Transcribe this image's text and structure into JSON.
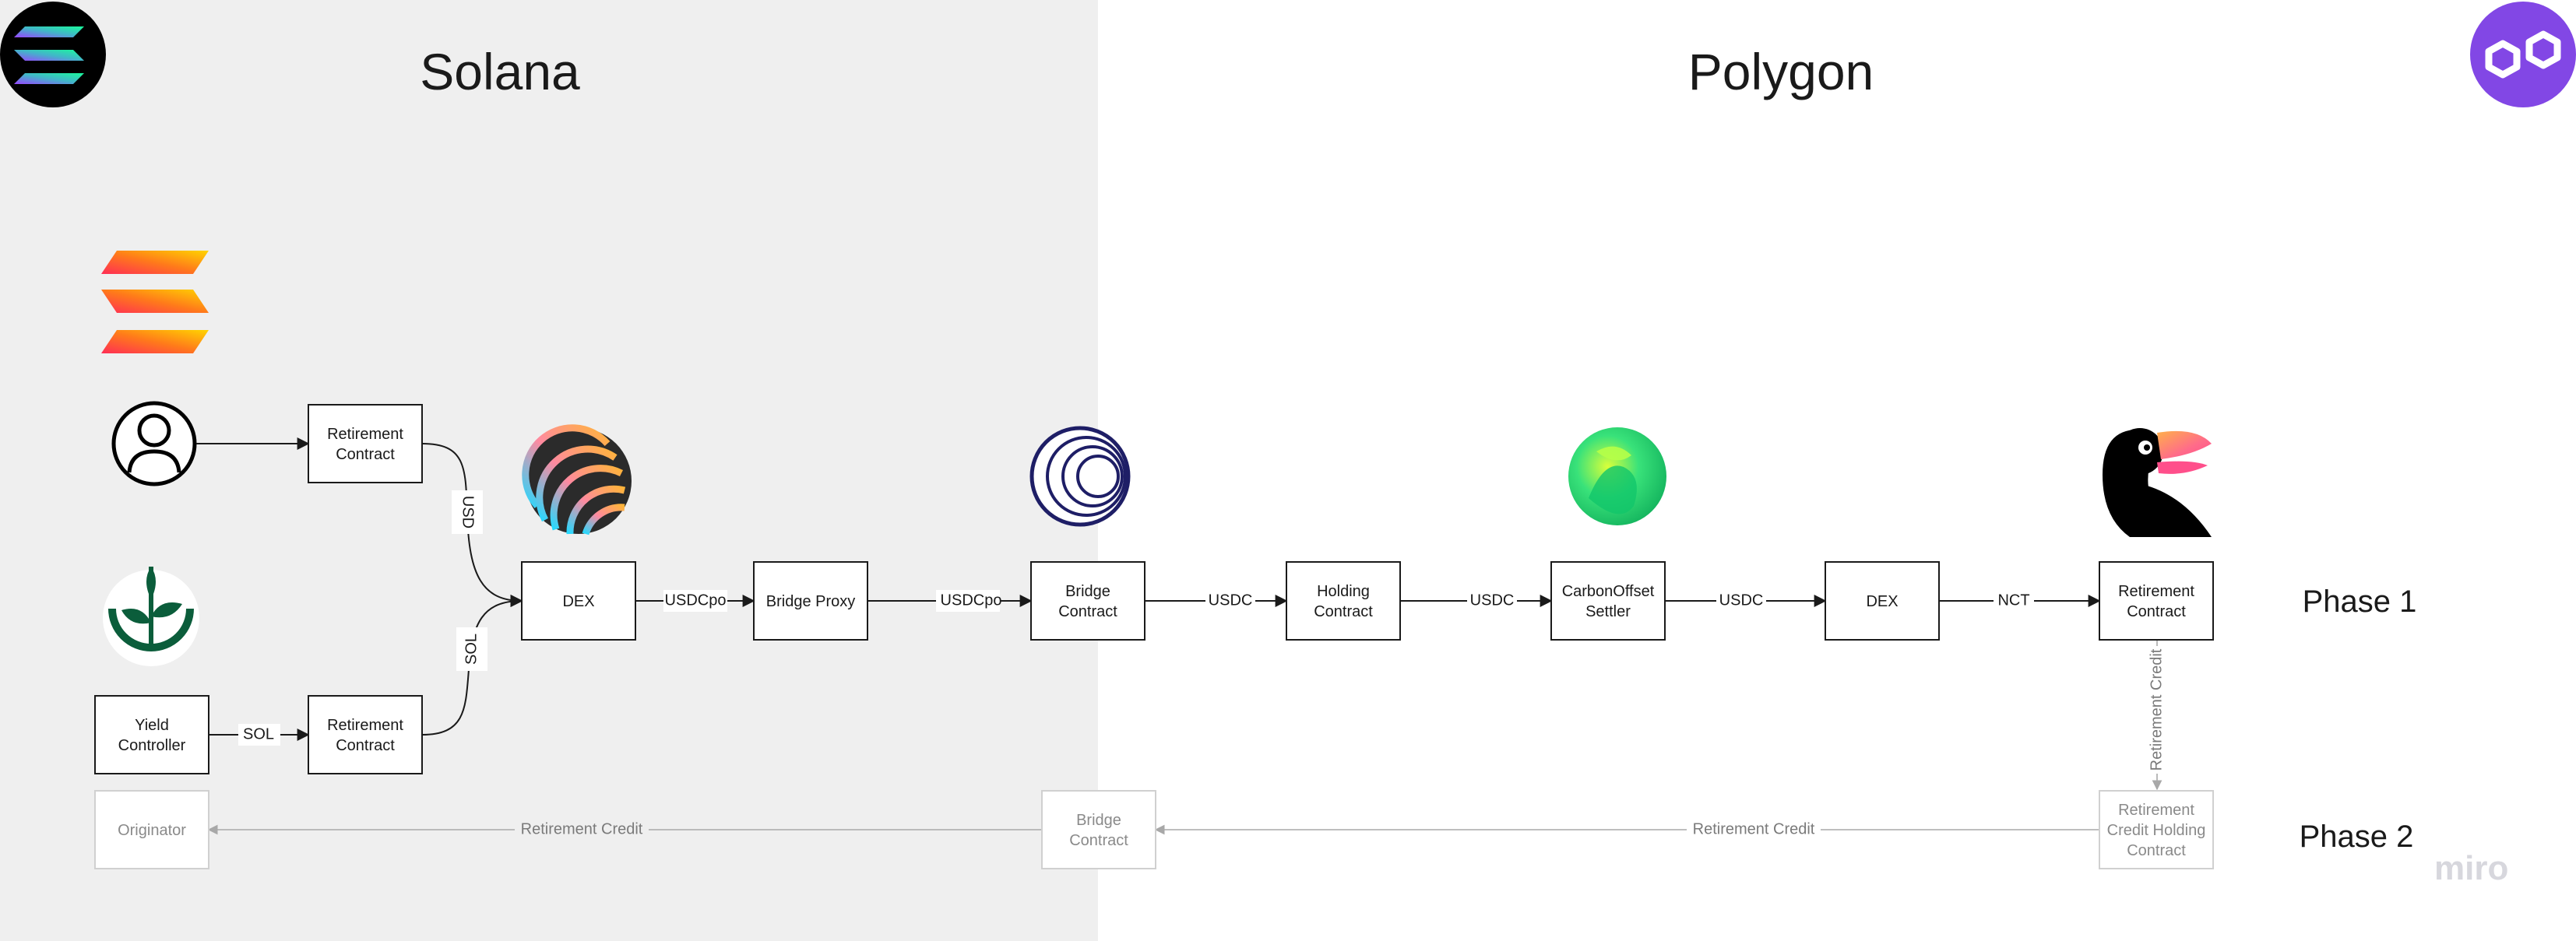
{
  "regions": {
    "left": {
      "title": "Solana"
    },
    "right": {
      "title": "Polygon"
    }
  },
  "colors": {
    "left_background": "#efefef",
    "right_background": "#ffffff",
    "node_border": "#1a1a1a",
    "faded_node_border": "#d0d0d0",
    "faded_text": "#8a8a8a",
    "polygon_purple": "#8247e5"
  },
  "icons": {
    "solana_logo": "solana-logo-icon",
    "polygon_logo": "polygon-logo-icon",
    "solana_orange": "solana-orange-logo-icon",
    "user": "user-icon",
    "plant": "plant-seedling-icon",
    "dex": "orca-striped-logo-icon",
    "bridge": "wormhole-circles-icon",
    "carbon": "green-blob-logo-icon",
    "toucan": "toucan-logo-icon"
  },
  "nodes": {
    "retirement_contract_top": [
      "Retirement",
      "Contract"
    ],
    "yield_controller": [
      "Yield",
      "Controller"
    ],
    "retirement_contract_bottom": [
      "Retirement",
      "Contract"
    ],
    "dex_solana": [
      "DEX"
    ],
    "bridge_proxy": [
      "Bridge Proxy"
    ],
    "bridge_contract": [
      "Bridge",
      "Contract"
    ],
    "holding_contract": [
      "Holding",
      "Contract"
    ],
    "carbon_offset_settler": [
      "CarbonOffset",
      "Settler"
    ],
    "dex_polygon": [
      "DEX"
    ],
    "retirement_contract_polygon": [
      "Retirement",
      "Contract"
    ],
    "retirement_credit_holding": [
      "Retirement",
      "Credit Holding",
      "Contract"
    ],
    "bridge_contract_phase2": [
      "Bridge",
      "Contract"
    ],
    "originator": [
      "Originator"
    ]
  },
  "edges": {
    "usd": "USD",
    "sol_curve": "SOL",
    "sol_straight": "SOL",
    "usdcpo_1": "USDCpo",
    "usdcpo_2": "USDCpo",
    "usdc_1": "USDC",
    "usdc_2": "USDC",
    "usdc_3": "USDC",
    "nct": "NCT",
    "retirement_credit_vertical": "Retirement Credit",
    "retirement_credit_right": "Retirement Credit",
    "retirement_credit_left": "Retirement Credit"
  },
  "phases": {
    "phase1": "Phase 1",
    "phase2": "Phase 2"
  },
  "watermark": "miro"
}
